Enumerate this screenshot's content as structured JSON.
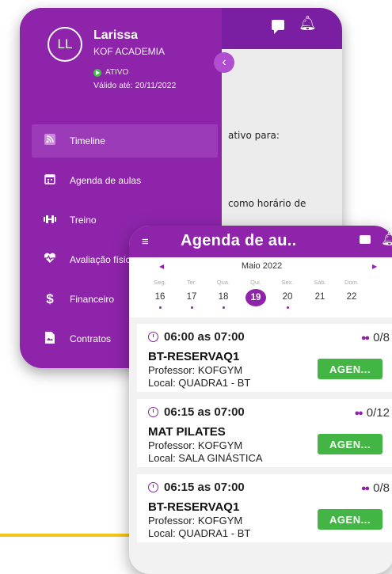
{
  "colors": {
    "brand": "#8e24aa",
    "accent_yellow": "#f5c518",
    "button_green": "#43b545"
  },
  "back_screen": {
    "content_line1": "ativo para:",
    "content_line2": "como horário de",
    "profile": {
      "initials": "LL",
      "name": "Larissa",
      "gym": "KOF ACADEMIA",
      "status": "ATIVO",
      "valid_until": "Válido até: 20/11/2022"
    },
    "menu": [
      {
        "label": "Timeline",
        "icon": "rss-icon"
      },
      {
        "label": "Agenda de aulas",
        "icon": "calendar-icon"
      },
      {
        "label": "Treino",
        "icon": "dumbbell-icon"
      },
      {
        "label": "Avaliação físic",
        "icon": "heartbeat-icon"
      },
      {
        "label": "Financeiro",
        "icon": "dollar-icon"
      },
      {
        "label": "Contratos",
        "icon": "document-icon"
      }
    ]
  },
  "front_screen": {
    "title": "Agenda de au..",
    "calendar": {
      "month": "Maio 2022",
      "days": [
        {
          "weekday": "Seg.",
          "day": "16"
        },
        {
          "weekday": "Ter.",
          "day": "17"
        },
        {
          "weekday": "Qua.",
          "day": "18"
        },
        {
          "weekday": "Qui.",
          "day": "19"
        },
        {
          "weekday": "Sex.",
          "day": "20"
        },
        {
          "weekday": "Sáb.",
          "day": "21"
        },
        {
          "weekday": "Dom.",
          "day": "22"
        }
      ],
      "selected_day": "19"
    },
    "classes": [
      {
        "time": "06:00 as 07:00",
        "count": "0/8",
        "name": "BT-RESERVAQ1",
        "professor": "Professor: KOFGYM",
        "local": "Local: QUADRA1 - BT",
        "button": "AGEN..."
      },
      {
        "time": "06:15 as 07:00",
        "count": "0/12",
        "name": "MAT PILATES",
        "professor": "Professor: KOFGYM",
        "local": "Local: SALA GINÁSTICA",
        "button": "AGEN..."
      },
      {
        "time": "06:15 as 07:00",
        "count": "0/8",
        "name": "BT-RESERVAQ1",
        "professor": "Professor: KOFGYM",
        "local": "Local: QUADRA1 - BT",
        "button": "AGEN..."
      }
    ]
  }
}
